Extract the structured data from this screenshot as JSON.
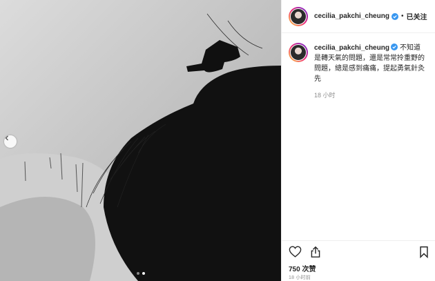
{
  "post": {
    "username": "cecilia_pakchi_cheung",
    "header_separator": "•",
    "follow_label": "已关注",
    "caption_text": "不知道是轉天氣的問題，還是常常拎重野的問題，總是感到痛痛，提起勇氣針灸先",
    "time_ago": "18 小时",
    "likes": "750 次赞",
    "date": "18 小时前"
  },
  "icons": {
    "verified": "verified-badge-icon",
    "like": "heart-icon",
    "share": "share-icon",
    "save": "bookmark-icon",
    "prev": "chevron-left-icon"
  },
  "colors": {
    "verified_blue": "#3897f0",
    "muted": "#8e8e8e",
    "text": "#262626"
  },
  "carousel": {
    "slides": 2,
    "active_index": 1
  }
}
